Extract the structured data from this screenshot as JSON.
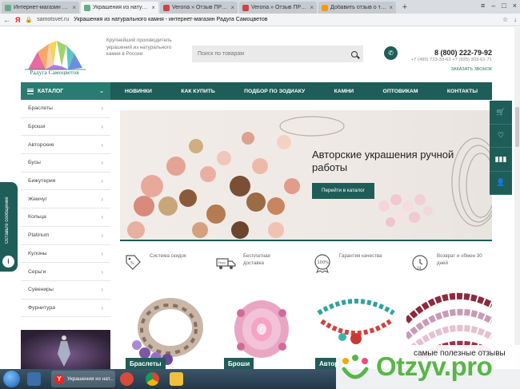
{
  "browser": {
    "tabs": [
      {
        "title": "Интернет-магазин украшений",
        "active": false
      },
      {
        "title": "Украшения из натуральн",
        "active": true
      },
      {
        "title": "Verona » Отзыв ПРО - реа",
        "active": false
      },
      {
        "title": "Verona » Отзыв ПРО - реа",
        "active": false
      },
      {
        "title": "Добавить отзыв о товаре",
        "active": false
      }
    ],
    "url": "samotsvet.ru",
    "page_title": "Украшения из натурального камня - интернет-магазин Радуга Самоцветов"
  },
  "header": {
    "logo_text": "Радуга Самоцветов",
    "tagline": "Крупнейший производитель украшений из натурального камня в России",
    "search_placeholder": "Поиск по товарам",
    "phone_main": "8 (800) 222-79-92",
    "phone_extra": "+7 (495) 723-33-63 +7 (925) 303-61-71",
    "callback": "Заказать звонок"
  },
  "nav": {
    "catalog": "Каталог",
    "items": [
      "Новинки",
      "Как купить",
      "Подбор по зодиаку",
      "Камни",
      "Оптовикам",
      "Контакты"
    ]
  },
  "sidebar": {
    "items": [
      "Браслеты",
      "Броши",
      "Авторские",
      "Бусы",
      "Бижутерия",
      "Жемчуг",
      "Кольца",
      "Platinum",
      "Кулоны",
      "Серьги",
      "Сувениры",
      "Фурнитура"
    ]
  },
  "banner": {
    "title": "Авторские украшения ручной работы",
    "button": "Перейти в каталог"
  },
  "features": [
    {
      "text": "Система скидок"
    },
    {
      "text": "Бесплатная доставка"
    },
    {
      "text": "Гарантия качества"
    },
    {
      "text": "Возврат и обмен 30 дней"
    }
  ],
  "feature_badges": {
    "free": "free",
    "quality": "100%",
    "days": "24"
  },
  "categories": [
    {
      "label": "Браслеты"
    },
    {
      "label": "Броши"
    },
    {
      "label": "Автор"
    }
  ],
  "feedback_tab": "Оставьте сообщение",
  "taskbar": {
    "app_title": "Украшения из нат..."
  },
  "watermark": {
    "top": "самые полезные отзывы",
    "logo": "Otzyv.pro"
  },
  "colors": {
    "brand": "#1f5d58",
    "accent": "#2a7c73"
  }
}
